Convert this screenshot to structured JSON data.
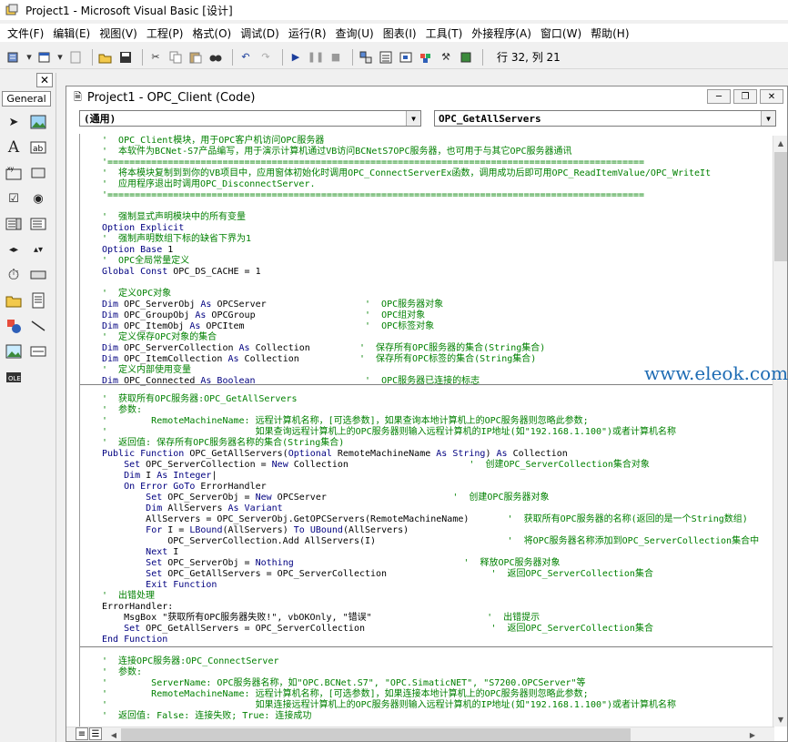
{
  "window": {
    "title": "Project1 - Microsoft Visual Basic [设计]"
  },
  "menu": [
    "文件(F)",
    "编辑(E)",
    "视图(V)",
    "工程(P)",
    "格式(O)",
    "调试(D)",
    "运行(R)",
    "查询(U)",
    "图表(I)",
    "工具(T)",
    "外接程序(A)",
    "窗口(W)",
    "帮助(H)"
  ],
  "toolbar": {
    "position_label": "行 32, 列 21",
    "icons": [
      "add-project-icon",
      "add-form-icon",
      "menu-editor-icon",
      "open-icon",
      "save-icon",
      "cut-icon",
      "copy-icon",
      "paste-icon",
      "find-icon",
      "undo-icon",
      "redo-icon",
      "run-icon",
      "pause-icon",
      "stop-icon",
      "project-explorer-icon",
      "properties-icon",
      "form-layout-icon",
      "object-browser-icon",
      "toolbox-icon",
      "data-view-icon"
    ]
  },
  "toolbox": {
    "tab": "General",
    "tools": [
      "pointer-icon",
      "picturebox-icon",
      "label-icon",
      "textbox-icon",
      "frame-icon",
      "commandbutton-icon",
      "checkbox-icon",
      "optionbutton-icon",
      "combobox-icon",
      "listbox-icon",
      "hscrollbar-icon",
      "vscrollbar-icon",
      "timer-icon",
      "drivelistbox-icon",
      "dirlistbox-icon",
      "filelistbox-icon",
      "shape-icon",
      "line-icon",
      "image-icon",
      "data-icon",
      "ole-icon"
    ]
  },
  "code_window": {
    "title": "Project1 - OPC_Client (Code)",
    "object_combo": "(通用)",
    "procedure_combo": "OPC_GetAllServers"
  },
  "code": {
    "section1": [
      [
        [
          "cm",
          "'  OPC_Client模块，用于OPC客户机访问OPC服务器"
        ]
      ],
      [
        [
          "cm",
          "'  本软件为BCNet-S7产品编写，用于演示计算机通过VB访问BCNetS7OPC服务器，也可用于与其它OPC服务器通讯"
        ]
      ],
      [
        [
          "cm",
          "'=================================================================================================="
        ]
      ],
      [
        [
          "cm",
          "'  将本模块复制到到你的VB项目中，应用窗体初始化时调用OPC_ConnectServerEx函数，调用成功后即可用OPC_ReadItemValue/OPC_WriteIt"
        ]
      ],
      [
        [
          "cm",
          "'  应用程序退出时调用OPC_DisconnectServer."
        ]
      ],
      [
        [
          "cm",
          "'=================================================================================================="
        ]
      ],
      [
        [
          "pl",
          ""
        ]
      ],
      [
        [
          "cm",
          "'  强制显式声明模块中的所有变量"
        ]
      ],
      [
        [
          "kw",
          "Option Explicit"
        ]
      ],
      [
        [
          "cm",
          "'  强制声明数组下标的缺省下界为1"
        ]
      ],
      [
        [
          "kw",
          "Option Base"
        ],
        [
          "pl",
          " 1"
        ]
      ],
      [
        [
          "cm",
          "'  OPC全局常量定义"
        ]
      ],
      [
        [
          "kw",
          "Global Const"
        ],
        [
          "pl",
          " OPC_DS_CACHE = 1"
        ]
      ],
      [
        [
          "pl",
          ""
        ]
      ],
      [
        [
          "cm",
          "'  定义OPC对象"
        ]
      ],
      [
        [
          "kw",
          "Dim"
        ],
        [
          "pl",
          " OPC_ServerObj "
        ],
        [
          "kw",
          "As"
        ],
        [
          "pl",
          " OPCServer                  "
        ],
        [
          "cm",
          "'  OPC服务器对象"
        ]
      ],
      [
        [
          "kw",
          "Dim"
        ],
        [
          "pl",
          " OPC_GroupObj "
        ],
        [
          "kw",
          "As"
        ],
        [
          "pl",
          " OPCGroup                    "
        ],
        [
          "cm",
          "'  OPC组对象"
        ]
      ],
      [
        [
          "kw",
          "Dim"
        ],
        [
          "pl",
          " OPC_ItemObj "
        ],
        [
          "kw",
          "As"
        ],
        [
          "pl",
          " OPCItem                      "
        ],
        [
          "cm",
          "'  OPC标签对象"
        ]
      ],
      [
        [
          "cm",
          "'  定义保存OPC对象的集合"
        ]
      ],
      [
        [
          "kw",
          "Dim"
        ],
        [
          "pl",
          " OPC_ServerCollection "
        ],
        [
          "kw",
          "As"
        ],
        [
          "pl",
          " Collection         "
        ],
        [
          "cm",
          "'  保存所有OPC服务器的集合(String集合)"
        ]
      ],
      [
        [
          "kw",
          "Dim"
        ],
        [
          "pl",
          " OPC_ItemCollection "
        ],
        [
          "kw",
          "As"
        ],
        [
          "pl",
          " Collection           "
        ],
        [
          "cm",
          "'  保存所有OPC标签的集合(String集合)"
        ]
      ],
      [
        [
          "cm",
          "'  定义内部使用变量"
        ]
      ],
      [
        [
          "kw",
          "Dim"
        ],
        [
          "pl",
          " OPC_Connected "
        ],
        [
          "kw",
          "As Boolean"
        ],
        [
          "pl",
          "                    "
        ],
        [
          "cm",
          "'  OPC服务器已连接的标志"
        ]
      ]
    ],
    "section2": [
      [
        [
          "cm",
          "'  获取所有OPC服务器:OPC_GetAllServers"
        ]
      ],
      [
        [
          "cm",
          "'  参数:"
        ]
      ],
      [
        [
          "cm",
          "'        RemoteMachineName: 远程计算机名称，[可选参数]，如果查询本地计算机上的OPC服务器则忽略此参数;"
        ]
      ],
      [
        [
          "cm",
          "'                           如果查询远程计算机上的OPC服务器则输入远程计算机的IP地址(如\"192.168.1.100\")或者计算机名称"
        ]
      ],
      [
        [
          "cm",
          "'  返回值: 保存所有OPC服务器名称的集合(String集合)"
        ]
      ],
      [
        [
          "kw",
          "Public Function"
        ],
        [
          "pl",
          " OPC_GetAllServers("
        ],
        [
          "kw",
          "Optional"
        ],
        [
          "pl",
          " RemoteMachineName "
        ],
        [
          "kw",
          "As String"
        ],
        [
          "pl",
          ") "
        ],
        [
          "kw",
          "As"
        ],
        [
          "pl",
          " Collection"
        ]
      ],
      [
        [
          "pl",
          "    "
        ],
        [
          "kw",
          "Set"
        ],
        [
          "pl",
          " OPC_ServerCollection = "
        ],
        [
          "kw",
          "New"
        ],
        [
          "pl",
          " Collection                      "
        ],
        [
          "cm",
          "'  创建OPC_ServerCollection集合对象"
        ]
      ],
      [
        [
          "pl",
          "    "
        ],
        [
          "kw",
          "Dim"
        ],
        [
          "pl",
          " I "
        ],
        [
          "kw",
          "As Integer"
        ],
        [
          "pl",
          "|"
        ]
      ],
      [
        [
          "pl",
          "    "
        ],
        [
          "kw",
          "On Error GoTo"
        ],
        [
          "pl",
          " ErrorHandler"
        ]
      ],
      [
        [
          "pl",
          "        "
        ],
        [
          "kw",
          "Set"
        ],
        [
          "pl",
          " OPC_ServerObj = "
        ],
        [
          "kw",
          "New"
        ],
        [
          "pl",
          " OPCServer                       "
        ],
        [
          "cm",
          "'  创建OPC服务器对象"
        ]
      ],
      [
        [
          "pl",
          "        "
        ],
        [
          "kw",
          "Dim"
        ],
        [
          "pl",
          " AllServers "
        ],
        [
          "kw",
          "As Variant"
        ]
      ],
      [
        [
          "pl",
          "        AllServers = OPC_ServerObj.GetOPCServers(RemoteMachineName)       "
        ],
        [
          "cm",
          "'  获取所有OPC服务器的名称(返回的是一个String数组)"
        ]
      ],
      [
        [
          "pl",
          "        "
        ],
        [
          "kw",
          "For"
        ],
        [
          "pl",
          " I = "
        ],
        [
          "kw",
          "LBound"
        ],
        [
          "pl",
          "(AllServers) "
        ],
        [
          "kw",
          "To"
        ],
        [
          "pl",
          " "
        ],
        [
          "kw",
          "UBound"
        ],
        [
          "pl",
          "(AllServers)"
        ]
      ],
      [
        [
          "pl",
          "            OPC_ServerCollection.Add AllServers(I)                        "
        ],
        [
          "cm",
          "'  将OPC服务器名称添加到OPC_ServerCollection集合中"
        ]
      ],
      [
        [
          "pl",
          "        "
        ],
        [
          "kw",
          "Next"
        ],
        [
          "pl",
          " I"
        ]
      ],
      [
        [
          "pl",
          "        "
        ],
        [
          "kw",
          "Set"
        ],
        [
          "pl",
          " OPC_ServerObj = "
        ],
        [
          "kw",
          "Nothing"
        ],
        [
          "pl",
          "                               "
        ],
        [
          "cm",
          "'  释放OPC服务器对象"
        ]
      ],
      [
        [
          "pl",
          "        "
        ],
        [
          "kw",
          "Set"
        ],
        [
          "pl",
          " OPC_GetAllServers = OPC_ServerCollection                   "
        ],
        [
          "cm",
          "'  返回OPC_ServerCollection集合"
        ]
      ],
      [
        [
          "pl",
          "        "
        ],
        [
          "kw",
          "Exit Function"
        ]
      ],
      [
        [
          "cm",
          "'  出错处理"
        ]
      ],
      [
        [
          "pl",
          "ErrorHandler:"
        ]
      ],
      [
        [
          "pl",
          "    MsgBox \"获取所有OPC服务器失败!\", vbOKOnly, \"错误\"                     "
        ],
        [
          "cm",
          "'  出错提示"
        ]
      ],
      [
        [
          "pl",
          "    "
        ],
        [
          "kw",
          "Set"
        ],
        [
          "pl",
          " OPC_GetAllServers = OPC_ServerCollection                       "
        ],
        [
          "cm",
          "'  返回OPC_ServerCollection集合"
        ]
      ],
      [
        [
          "kw",
          "End Function"
        ]
      ]
    ],
    "section3": [
      [
        [
          "cm",
          "'  连接OPC服务器:OPC_ConnectServer"
        ]
      ],
      [
        [
          "cm",
          "'  参数:"
        ]
      ],
      [
        [
          "cm",
          "'        ServerName: OPC服务器名称，如\"OPC.BCNet.S7\", \"OPC.SimaticNET\", \"S7200.OPCServer\"等"
        ]
      ],
      [
        [
          "cm",
          "'        RemoteMachineName: 远程计算机名称，[可选参数]，如果连接本地计算机上的OPC服务器则忽略此参数;"
        ]
      ],
      [
        [
          "cm",
          "'                           如果连接远程计算机上的OPC服务器则输入远程计算机的IP地址(如\"192.168.1.100\")或者计算机名称"
        ]
      ],
      [
        [
          "cm",
          "'  返回值: False: 连接失败; True: 连接成功"
        ]
      ]
    ]
  },
  "watermark": "www.eleok.com"
}
